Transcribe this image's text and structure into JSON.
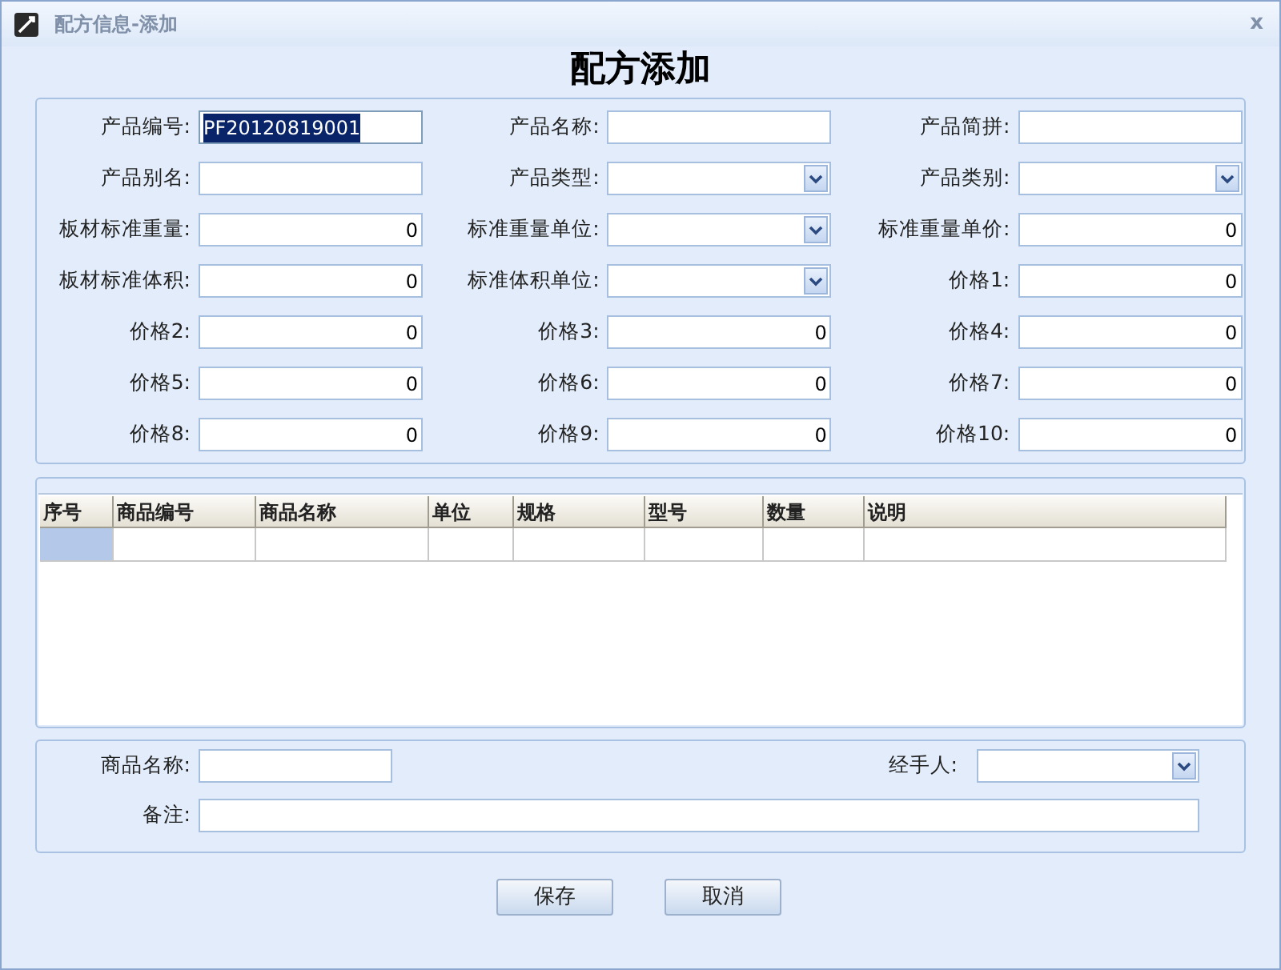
{
  "window": {
    "title": "配方信息-添加",
    "close": "x"
  },
  "heading": "配方添加",
  "form_fields": [
    {
      "label": "产品编号:",
      "kind": "text",
      "value": "PF20120819001",
      "highlighted": true
    },
    {
      "label": "产品名称:",
      "kind": "text",
      "highlighted": false
    },
    {
      "label": "产品简拼:",
      "kind": "text",
      "highlighted": false
    },
    {
      "label": "产品别名:",
      "kind": "text",
      "highlighted": false
    },
    {
      "label": "产品类型:",
      "kind": "select",
      "highlighted": false
    },
    {
      "label": "产品类别:",
      "kind": "select",
      "highlighted": false
    },
    {
      "label": "板材标准重量:",
      "kind": "number",
      "value": "0",
      "highlighted": false
    },
    {
      "label": "标准重量单位:",
      "kind": "select",
      "highlighted": false
    },
    {
      "label": "标准重量单价:",
      "kind": "number",
      "value": "0",
      "highlighted": false
    },
    {
      "label": "板材标准体积:",
      "kind": "number",
      "value": "0",
      "highlighted": false
    },
    {
      "label": "标准体积单位:",
      "kind": "select",
      "highlighted": false
    },
    {
      "label": "价格1:",
      "kind": "number",
      "value": "0",
      "highlighted": false
    },
    {
      "label": "价格2:",
      "kind": "number",
      "value": "0",
      "highlighted": false
    },
    {
      "label": "价格3:",
      "kind": "number",
      "value": "0",
      "highlighted": false
    },
    {
      "label": "价格4:",
      "kind": "number",
      "value": "0",
      "highlighted": false
    },
    {
      "label": "价格5:",
      "kind": "number",
      "value": "0",
      "highlighted": false
    },
    {
      "label": "价格6:",
      "kind": "number",
      "value": "0",
      "highlighted": false
    },
    {
      "label": "价格7:",
      "kind": "number",
      "value": "0",
      "highlighted": false
    },
    {
      "label": "价格8:",
      "kind": "number",
      "value": "0",
      "highlighted": false
    },
    {
      "label": "价格9:",
      "kind": "number",
      "value": "0",
      "highlighted": false
    },
    {
      "label": "价格10:",
      "kind": "number",
      "value": "0",
      "highlighted": false
    }
  ],
  "table": {
    "columns": [
      "序号",
      "商品编号",
      "商品名称",
      "单位",
      "规格",
      "型号",
      "数量",
      "说明"
    ],
    "rows": [
      {
        "selected": true
      }
    ]
  },
  "bottom": {
    "product_name_label": "商品名称:",
    "handler_label": "经手人:",
    "remark_label": "备注:"
  },
  "buttons": [
    "保存",
    "取消"
  ]
}
